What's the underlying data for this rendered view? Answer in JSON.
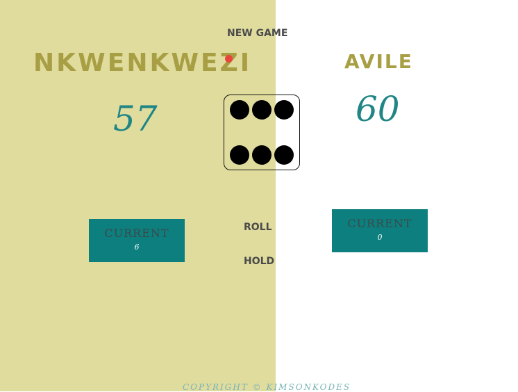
{
  "players": [
    {
      "name": "NKWENKWEZI",
      "score": "57",
      "current_label": "CURRENT",
      "current_value": "6",
      "active": true
    },
    {
      "name": "AVILE",
      "score": "60",
      "current_label": "CURRENT",
      "current_value": "0",
      "active": false
    }
  ],
  "controls": {
    "new_game_label": "NEW GAME",
    "roll_label": "ROLL",
    "hold_label": "HOLD"
  },
  "dice": {
    "value": 6
  },
  "footer": {
    "text": "COPYRIGHT © KIMSONKODES"
  },
  "colors": {
    "active_panel": "#e0dc9d",
    "inactive_panel": "#ffffff",
    "name_color": "#a89f45",
    "score_color": "#1f8585",
    "current_box": "#0d7f7f",
    "active_indicator": "#e8463c"
  }
}
